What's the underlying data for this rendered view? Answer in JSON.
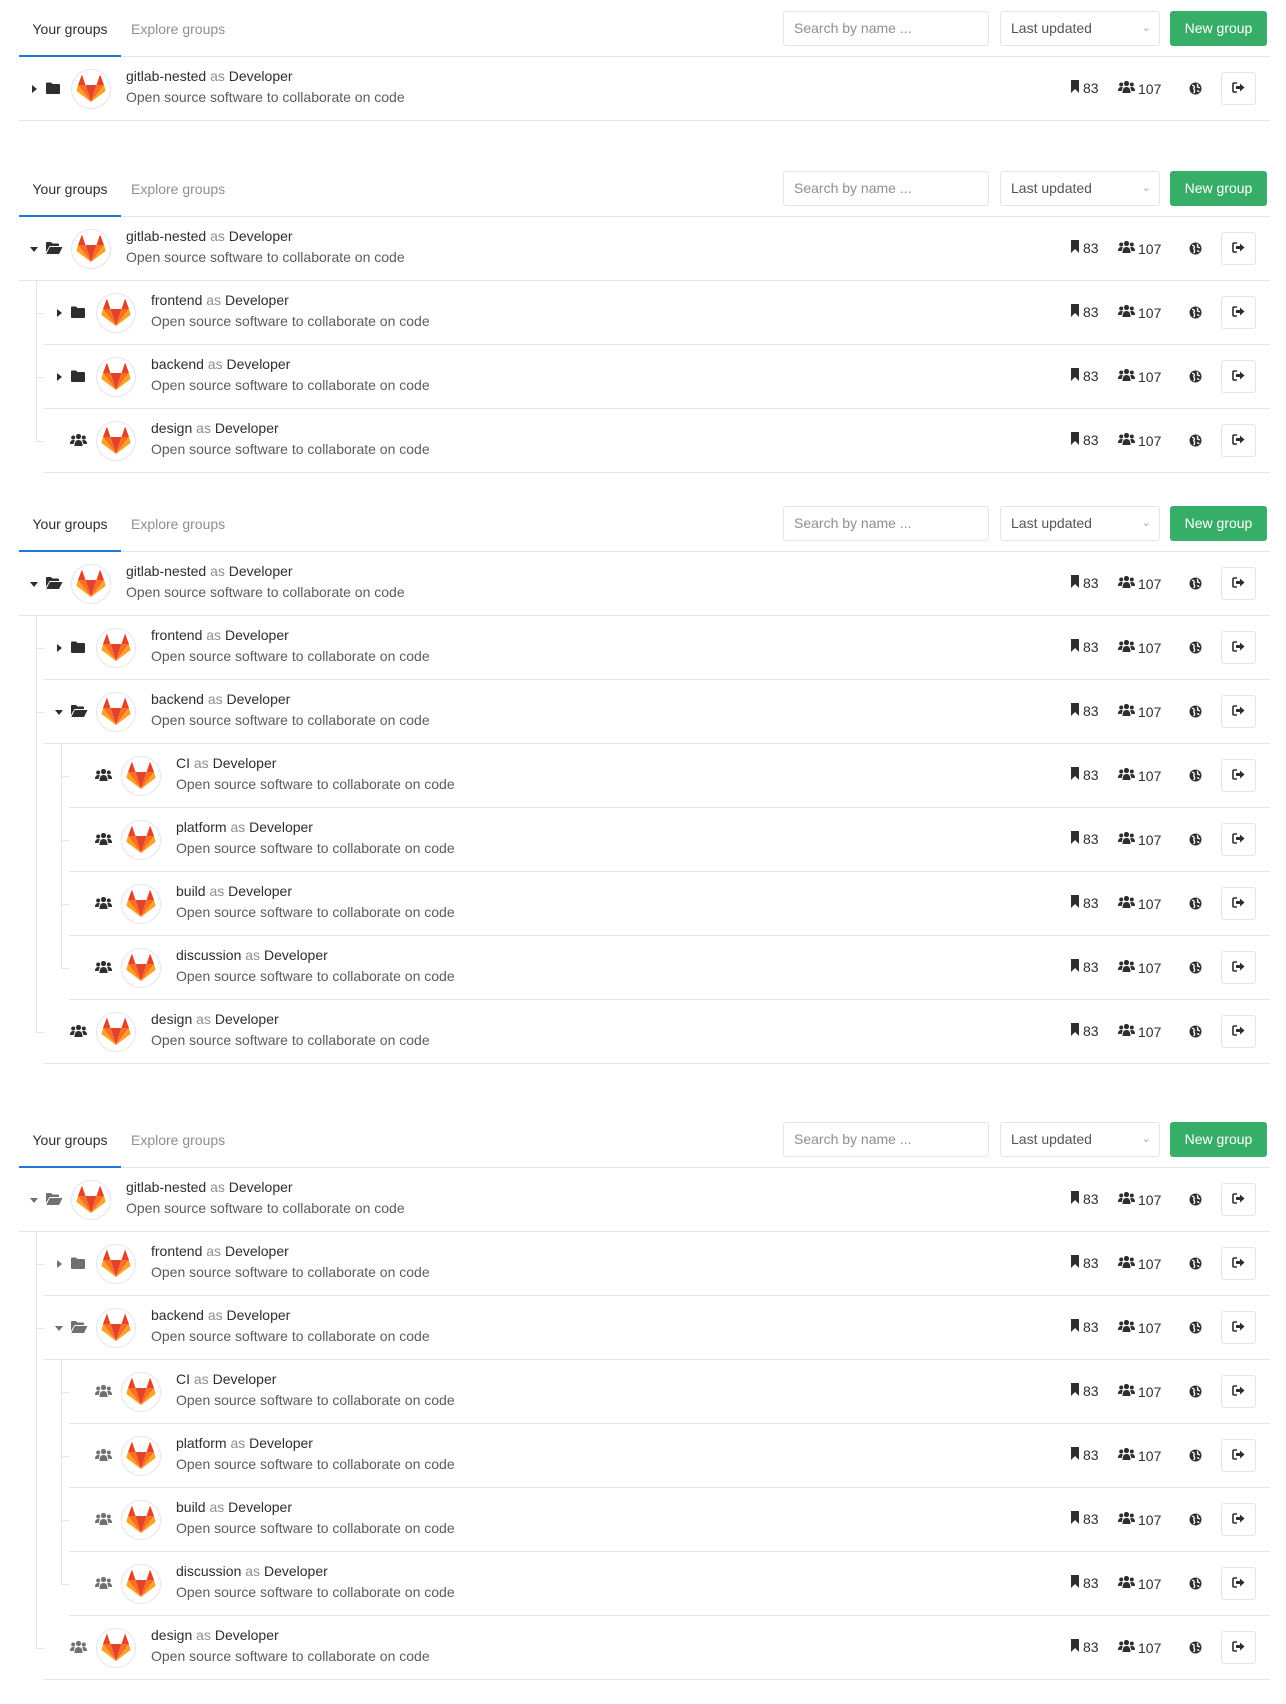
{
  "tabs": {
    "your": "Your groups",
    "explore": "Explore groups"
  },
  "search_placeholder": "Search by name ...",
  "sort_value": "Last updated",
  "new_group_label": "New group",
  "role_word": "as",
  "colors": {
    "accent": "#1f78d1",
    "button": "#37ae67",
    "icon_dark": "#2e2e2e",
    "icon_muted": "#707070"
  },
  "sections": [
    {
      "icon_color": "#2e2e2e",
      "groups": [
        {
          "name": "gitlab-nested",
          "role": "Developer",
          "description": "Open source software to collaborate on code",
          "state": "closed",
          "projects": "83",
          "members": "107",
          "children": []
        }
      ]
    },
    {
      "icon_color": "#2e2e2e",
      "groups": [
        {
          "name": "gitlab-nested",
          "role": "Developer",
          "description": "Open source software to collaborate on code",
          "state": "open",
          "projects": "83",
          "members": "107",
          "children": [
            {
              "name": "frontend",
              "role": "Developer",
              "description": "Open source software to collaborate on code",
              "state": "closed",
              "projects": "83",
              "members": "107",
              "children": []
            },
            {
              "name": "backend",
              "role": "Developer",
              "description": "Open source software to collaborate on code",
              "state": "closed",
              "projects": "83",
              "members": "107",
              "children": []
            },
            {
              "name": "design",
              "role": "Developer",
              "description": "Open source software to collaborate on code",
              "state": "leaf",
              "projects": "83",
              "members": "107",
              "children": []
            }
          ]
        }
      ]
    },
    {
      "icon_color": "#2e2e2e",
      "groups": [
        {
          "name": "gitlab-nested",
          "role": "Developer",
          "description": "Open source software to collaborate on code",
          "state": "open",
          "projects": "83",
          "members": "107",
          "children": [
            {
              "name": "frontend",
              "role": "Developer",
              "description": "Open source software to collaborate on code",
              "state": "closed",
              "projects": "83",
              "members": "107",
              "children": []
            },
            {
              "name": "backend",
              "role": "Developer",
              "description": "Open source software to collaborate on code",
              "state": "open",
              "projects": "83",
              "members": "107",
              "children": [
                {
                  "name": "CI",
                  "role": "Developer",
                  "description": "Open source software to collaborate on code",
                  "state": "leaf",
                  "projects": "83",
                  "members": "107",
                  "children": []
                },
                {
                  "name": "platform",
                  "role": "Developer",
                  "description": "Open source software to collaborate on code",
                  "state": "leaf",
                  "projects": "83",
                  "members": "107",
                  "children": []
                },
                {
                  "name": "build",
                  "role": "Developer",
                  "description": "Open source software to collaborate on code",
                  "state": "leaf",
                  "projects": "83",
                  "members": "107",
                  "children": []
                },
                {
                  "name": "discussion",
                  "role": "Developer",
                  "description": "Open source software to collaborate on code",
                  "state": "leaf",
                  "projects": "83",
                  "members": "107",
                  "children": []
                }
              ]
            },
            {
              "name": "design",
              "role": "Developer",
              "description": "Open source software to collaborate on code",
              "state": "leaf",
              "projects": "83",
              "members": "107",
              "children": []
            }
          ]
        }
      ]
    },
    {
      "icon_color": "#707070",
      "groups": [
        {
          "name": "gitlab-nested",
          "role": "Developer",
          "description": "Open source software to collaborate on code",
          "state": "open",
          "projects": "83",
          "members": "107",
          "children": [
            {
              "name": "frontend",
              "role": "Developer",
              "description": "Open source software to collaborate on code",
              "state": "closed",
              "projects": "83",
              "members": "107",
              "children": []
            },
            {
              "name": "backend",
              "role": "Developer",
              "description": "Open source software to collaborate on code",
              "state": "open",
              "projects": "83",
              "members": "107",
              "children": [
                {
                  "name": "CI",
                  "role": "Developer",
                  "description": "Open source software to collaborate on code",
                  "state": "leaf",
                  "projects": "83",
                  "members": "107",
                  "children": []
                },
                {
                  "name": "platform",
                  "role": "Developer",
                  "description": "Open source software to collaborate on code",
                  "state": "leaf",
                  "projects": "83",
                  "members": "107",
                  "children": []
                },
                {
                  "name": "build",
                  "role": "Developer",
                  "description": "Open source software to collaborate on code",
                  "state": "leaf",
                  "projects": "83",
                  "members": "107",
                  "children": []
                },
                {
                  "name": "discussion",
                  "role": "Developer",
                  "description": "Open source software to collaborate on code",
                  "state": "leaf",
                  "projects": "83",
                  "members": "107",
                  "children": []
                }
              ]
            },
            {
              "name": "design",
              "role": "Developer",
              "description": "Open source software to collaborate on code",
              "state": "leaf",
              "projects": "83",
              "members": "107",
              "children": []
            }
          ]
        }
      ]
    }
  ]
}
